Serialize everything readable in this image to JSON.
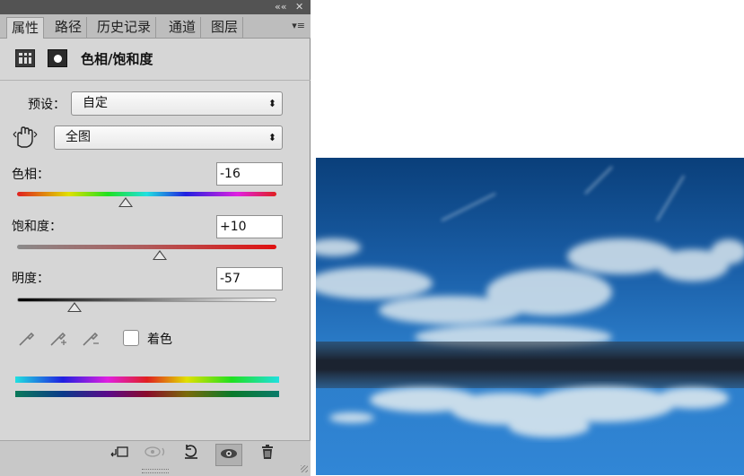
{
  "panel": {
    "topbar": {
      "collapse_glyph": "««",
      "close_glyph": "✕"
    },
    "tabs": [
      {
        "label": "属性",
        "active": true
      },
      {
        "label": "路径",
        "active": false
      },
      {
        "label": "历史记录",
        "active": false
      },
      {
        "label": "通道",
        "active": false
      },
      {
        "label": "图层",
        "active": false
      }
    ],
    "tab_menu_glyph": "▾≡",
    "title": "色相/饱和度",
    "preset": {
      "label": "预设：",
      "value": "自定"
    },
    "channel": {
      "value": "全图"
    },
    "hue": {
      "label": "色相：",
      "value": "-16",
      "slider_fraction": 0.42
    },
    "saturation": {
      "label": "饱和度：",
      "value": "+10",
      "slider_fraction": 0.55
    },
    "lightness": {
      "label": "明度：",
      "value": "-57",
      "slider_fraction": 0.22
    },
    "colorize": {
      "label": "着色",
      "checked": false
    },
    "select_arrow": "⬍",
    "footer_icons": [
      "clip-to-layer-icon",
      "visibility-preview-icon",
      "reset-icon",
      "eye-icon",
      "trash-icon"
    ]
  },
  "colors": {
    "panel_bg": "#d6d6d6",
    "sky_top": "#0a3f7a",
    "sky_mid": "#1f6fb8",
    "water": "#2b7fd0"
  }
}
